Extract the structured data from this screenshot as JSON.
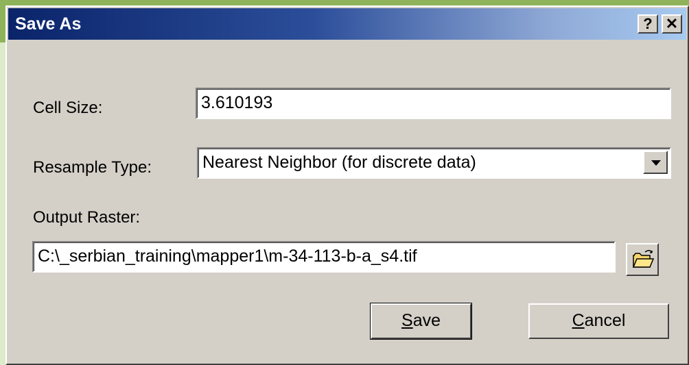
{
  "window": {
    "title": "Save As",
    "help_glyph": "?",
    "close_glyph": "✕"
  },
  "form": {
    "cell_size": {
      "label": "Cell Size:",
      "value": "3.610193"
    },
    "resample_type": {
      "label": "Resample Type:",
      "value": "Nearest Neighbor (for discrete data)"
    },
    "output_raster": {
      "label": "Output Raster:",
      "value": "C:\\_serbian_training\\mapper1\\m-34-113-b-a_s4.tif"
    }
  },
  "buttons": {
    "save": {
      "mnemonic": "S",
      "rest": "ave"
    },
    "cancel": {
      "mnemonic": "C",
      "rest": "ancel"
    }
  },
  "icons": {
    "help": "help-icon",
    "close": "close-icon",
    "browse": "open-folder-icon",
    "dropdown": "chevron-down-icon"
  },
  "colors": {
    "title_gradient_start": "#0a246a",
    "title_gradient_end": "#a6caf0",
    "dialog_face": "#d4d0c8",
    "background": "#8fb35b"
  }
}
